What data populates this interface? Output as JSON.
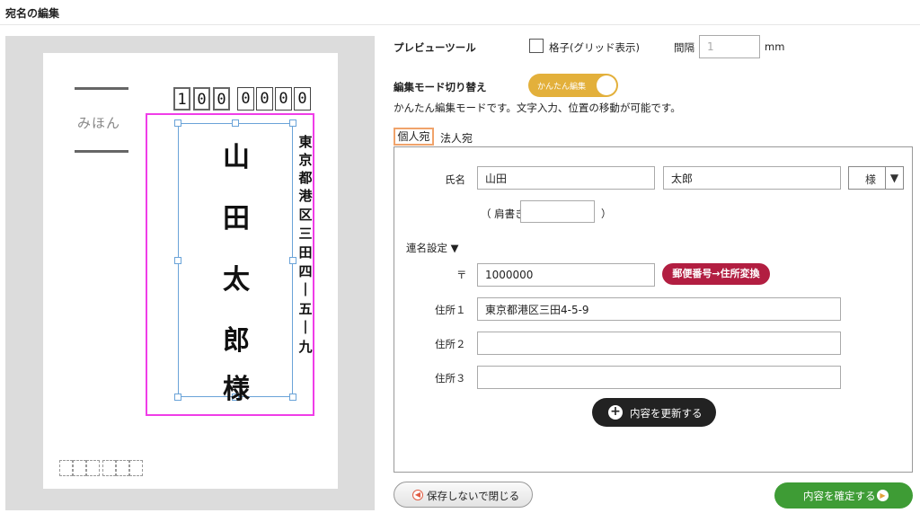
{
  "header": {
    "title": "宛名の編集"
  },
  "preview": {
    "sample_label": "みほん",
    "zip_digits": [
      "1",
      "0",
      "0",
      "0",
      "0",
      "0",
      "0"
    ],
    "name_chars": [
      "山",
      "田",
      "太",
      "郎",
      "様"
    ],
    "address_chars": [
      "東",
      "京",
      "都",
      "港",
      "区",
      "三",
      "田",
      "四",
      "|",
      "五",
      "|",
      "九"
    ]
  },
  "tools": {
    "preview_tool_label": "プレビューツール",
    "grid_label": "格子(グリッド表示)",
    "grid_checked": false,
    "interval_label": "間隔",
    "interval_placeholder": "1",
    "interval_unit": "mm"
  },
  "mode": {
    "label": "編集モード切り替え",
    "toggle_label": "かんたん編集",
    "description": "かんたん編集モードです。文字入力、位置の移動が可能です。"
  },
  "tabs": [
    {
      "label": "個人宛",
      "active": true
    },
    {
      "label": "法人宛",
      "active": false
    }
  ],
  "form": {
    "name_label": "氏名",
    "last_name": "山田",
    "first_name": "太郎",
    "honorific": "様",
    "title_label": "（ 肩書き",
    "title_close": "）",
    "title_value": "",
    "joint_names_label": "連名設定 ▼",
    "zip_label": "〒",
    "zip_value": "1000000",
    "zip_convert_label": "郵便番号→住所変換",
    "address1_label": "住所１",
    "address1_value": "東京都港区三田4-5-9",
    "address2_label": "住所２",
    "address2_value": "",
    "address3_label": "住所３",
    "address3_value": "",
    "update_label": "内容を更新する"
  },
  "footer": {
    "close_label": "保存しないで閉じる",
    "confirm_label": "内容を確定する"
  },
  "colors": {
    "select_frame": "#f03de8",
    "toggle": "#e3b03b",
    "convert_button": "#b21e41",
    "confirm_button": "#3e9c35"
  }
}
